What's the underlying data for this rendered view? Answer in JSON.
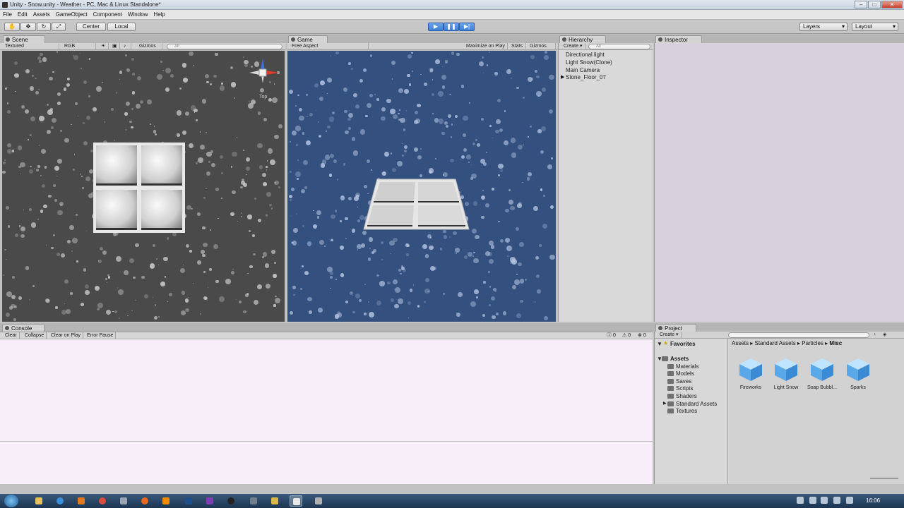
{
  "window": {
    "title": "Unity - Snow.unity - Weather - PC, Mac & Linux Standalone*"
  },
  "menu": [
    "File",
    "Edit",
    "Assets",
    "GameObject",
    "Component",
    "Window",
    "Help"
  ],
  "toolbar": {
    "pivot": "Center",
    "space": "Local",
    "layers": "Layers",
    "layout": "Layout",
    "play_state": "playing"
  },
  "scene": {
    "tab": "Scene",
    "shading": "Textured",
    "render": "RGB",
    "gizmos": "Gizmos",
    "search_placeholder": "All",
    "gizmo_label": "Top"
  },
  "game": {
    "tab": "Game",
    "aspect": "Free Aspect",
    "maximize": "Maximize on Play",
    "stats": "Stats",
    "gizmos": "Gizmos"
  },
  "hierarchy": {
    "tab": "Hierarchy",
    "create": "Create",
    "search_placeholder": "All",
    "items": [
      "Directional light",
      "Light Snow(Clone)",
      "Main Camera",
      "Stone_Floor_07"
    ]
  },
  "inspector": {
    "tab": "Inspector"
  },
  "console": {
    "tab": "Console",
    "buttons": [
      "Clear",
      "Collapse",
      "Clear on Play",
      "Error Pause"
    ],
    "counts": {
      "info": "0",
      "warnings": "0",
      "errors": "0"
    }
  },
  "project": {
    "tab": "Project",
    "create": "Create",
    "favorites": "Favorites",
    "assets_label": "Assets",
    "folders": [
      "Materials",
      "Models",
      "Saves",
      "Scripts",
      "Shaders",
      "Standard Assets",
      "Textures"
    ],
    "breadcrumb": [
      "Assets",
      "Standard Assets",
      "Particles",
      "Misc"
    ],
    "items": [
      "Fireworks",
      "Light Snow",
      "Soap Bubbl...",
      "Sparks"
    ]
  },
  "taskbar": {
    "clock": "16:06"
  },
  "colors": {
    "scene_bg": "#4a4a4a",
    "game_bg": "#33507e",
    "cube": "#5aa8e8",
    "play_active": "#3d7fd6"
  }
}
